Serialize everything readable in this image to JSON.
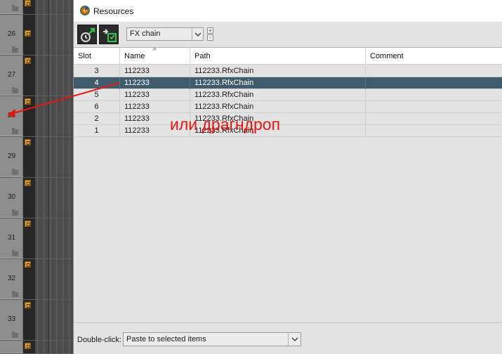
{
  "window": {
    "title": "Resources",
    "app_icon": "reaper-logo-icon"
  },
  "toolbar": {
    "button1_icon": "load-save-icon",
    "button2_icon": "sync-icon",
    "type_select": "FX chain",
    "plus": "+",
    "minus": "-"
  },
  "table": {
    "columns": [
      "Slot",
      "Name",
      "Path",
      "Comment"
    ],
    "sort_indicator": "^",
    "rows": [
      {
        "slot": "3",
        "name": "112233",
        "path": "112233.RfxChain",
        "comment": ""
      },
      {
        "slot": "4",
        "name": "112233",
        "path": "112233.RfxChain",
        "comment": "",
        "selected": true
      },
      {
        "slot": "5",
        "name": "112233",
        "path": "112233.RfxChain",
        "comment": ""
      },
      {
        "slot": "6",
        "name": "112233",
        "path": "112233.RfxChain",
        "comment": ""
      },
      {
        "slot": "2",
        "name": "112233",
        "path": "112233.RfxChain",
        "comment": ""
      },
      {
        "slot": "1",
        "name": "112233",
        "path": "112233.RfxChain",
        "comment": ""
      }
    ]
  },
  "annotation": {
    "text": "или драгндроп",
    "color": "#e8150f"
  },
  "footer": {
    "label": "Double-click:",
    "select": "Paste to selected items"
  },
  "tracks": {
    "numbers": [
      "26",
      "27",
      "28",
      "29",
      "30",
      "31",
      "32",
      "33"
    ],
    "fx_badge_icon": "fx-badge-icon",
    "folder_icon": "folder-icon"
  },
  "colors": {
    "selected_row": "#405c6c",
    "annotation": "#e8150f",
    "fx_badge": "#d6a031"
  }
}
